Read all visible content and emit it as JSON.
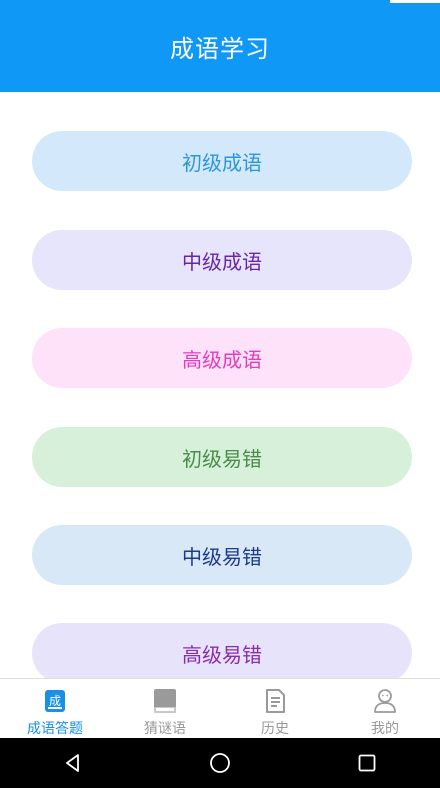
{
  "header": {
    "title": "成语学习"
  },
  "levels": [
    {
      "label": "初级成语",
      "bg": "#d3e9fb",
      "color": "#2c97d8"
    },
    {
      "label": "中级成语",
      "bg": "#e6e5fb",
      "color": "#6a26a8"
    },
    {
      "label": "高级成语",
      "bg": "#fde2fa",
      "color": "#e53bc0"
    },
    {
      "label": "初级易错",
      "bg": "#d7f0da",
      "color": "#4c8c4a"
    },
    {
      "label": "中级易错",
      "bg": "#d8e8f6",
      "color": "#1d3b8c"
    },
    {
      "label": "高级易错",
      "bg": "#e7e3fb",
      "color": "#8a2bb0"
    }
  ],
  "tabs": [
    {
      "label": "成语答题",
      "icon": "idiom-quiz-icon",
      "icon_char": "成",
      "active": true
    },
    {
      "label": "猜谜语",
      "icon": "book-icon",
      "active": false
    },
    {
      "label": "历史",
      "icon": "document-icon",
      "active": false
    },
    {
      "label": "我的",
      "icon": "user-icon",
      "active": false
    }
  ],
  "colors": {
    "accent": "#0f98f5",
    "tab_active": "#1890e8",
    "tab_inactive": "#999999"
  }
}
